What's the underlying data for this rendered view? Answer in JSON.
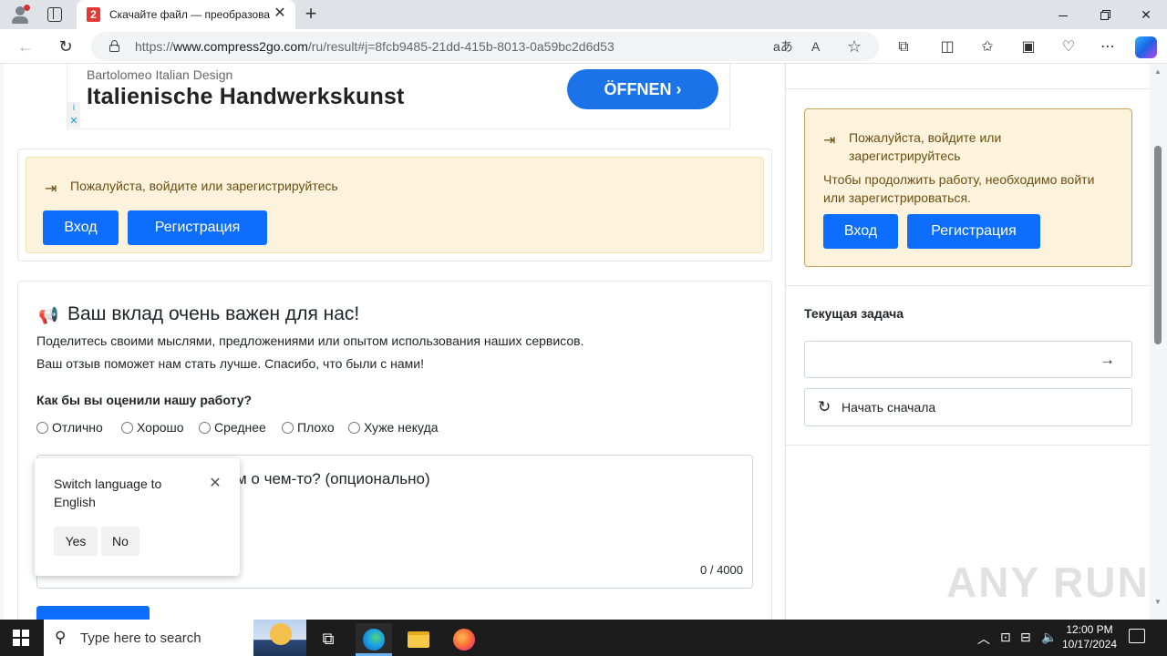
{
  "browser": {
    "tab_title": "Скачайте файл — преобразова",
    "tab_favicon": "2",
    "url_prefix": "https://",
    "url_domain": "www.compress2go.com",
    "url_path": "/ru/result#j=8fcb9485-21dd-415b-8013-0a59bc2d6d53",
    "read_aloud_label": "A",
    "translate_label": "aあ"
  },
  "ad": {
    "brand": "Bartolomeo Italian Design",
    "headline": "Italienische Handwerkskunst",
    "cta": "ÖFFNEN ›",
    "info": "i",
    "close": "✕"
  },
  "login_prompt": {
    "message": "Пожалуйста, войдите или зарегистрируйтесь",
    "login_label": "Вход",
    "register_label": "Регистрация"
  },
  "feedback": {
    "title": "Ваш вклад очень важен для нас!",
    "line1": "Поделитесь своими мыслями, предложениями или опытом использования наших сервисов.",
    "line2": "Ваш отзыв поможет нам стать лучше. Спасибо, что были с нами!",
    "question": "Как бы вы оценили нашу работу?",
    "ratings": [
      "Отлично",
      "Хорошо",
      "Среднее",
      "Плохо",
      "Хуже некуда"
    ],
    "textarea_placeholder_visible": "м о чем-то? (опционально)",
    "char_count": "0 / 4000"
  },
  "language_popup": {
    "text": "Switch language to English",
    "yes_label": "Yes",
    "no_label": "No"
  },
  "sidebar": {
    "alert_title": "Пожалуйста, войдите или зарегистрируйтесь",
    "alert_body": "Чтобы продолжить работу, необходимо войти или зарегистрироваться.",
    "login_label": "Вход",
    "register_label": "Регистрация",
    "current_task_heading": "Текущая задача",
    "current_task_value": "",
    "restart_label": "Начать сначала"
  },
  "watermark": "ANY RUN",
  "taskbar": {
    "search_placeholder": "Type here to search",
    "time": "12:00 PM",
    "date": "10/17/2024"
  },
  "colors": {
    "primary": "#0d6efd",
    "alert_bg": "#fdf3dc",
    "alert_text": "#6b4e12",
    "ad_button": "#1a73e8"
  }
}
